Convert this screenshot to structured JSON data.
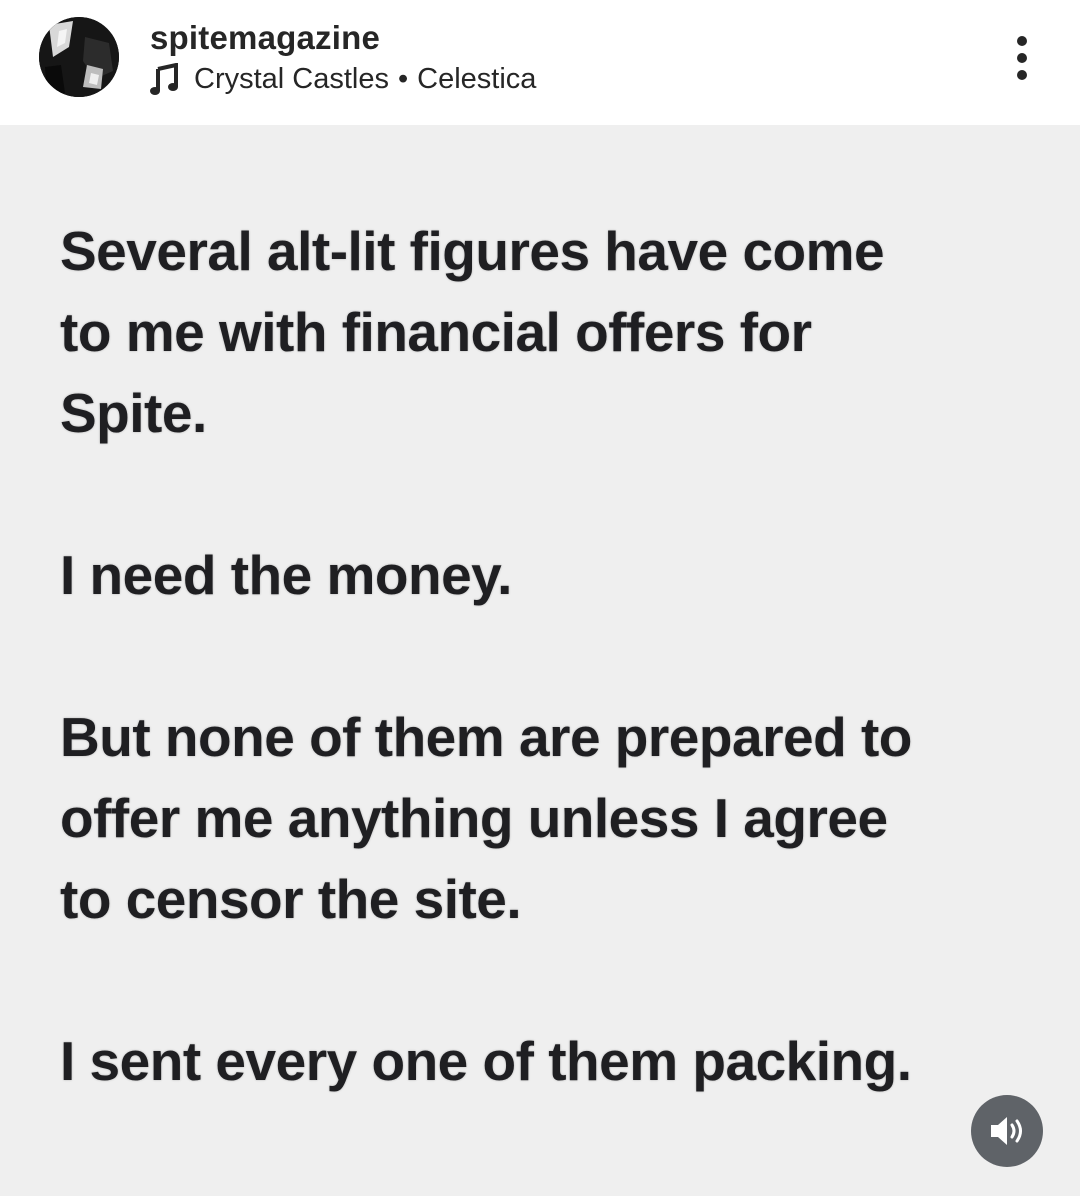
{
  "post": {
    "username": "spitemagazine",
    "audio": {
      "artist": "Crystal Castles",
      "separator": "•",
      "track": "Celestica"
    },
    "paragraphs": [
      "Several alt-lit figures have come\nto me with financial offers for\nSpite.",
      "I need the money.",
      "But none of them are prepared to\noffer me anything unless I agree\nto censor the site.",
      "I sent every one of them packing."
    ]
  },
  "icons": {
    "music": "music-note-icon",
    "more": "more-options-icon",
    "audio": "speaker-volume-icon"
  },
  "colors": {
    "header_background": "#ffffff",
    "media_background": "#efefef",
    "text": "#1f1f22",
    "audio_button": "#5f6368"
  }
}
